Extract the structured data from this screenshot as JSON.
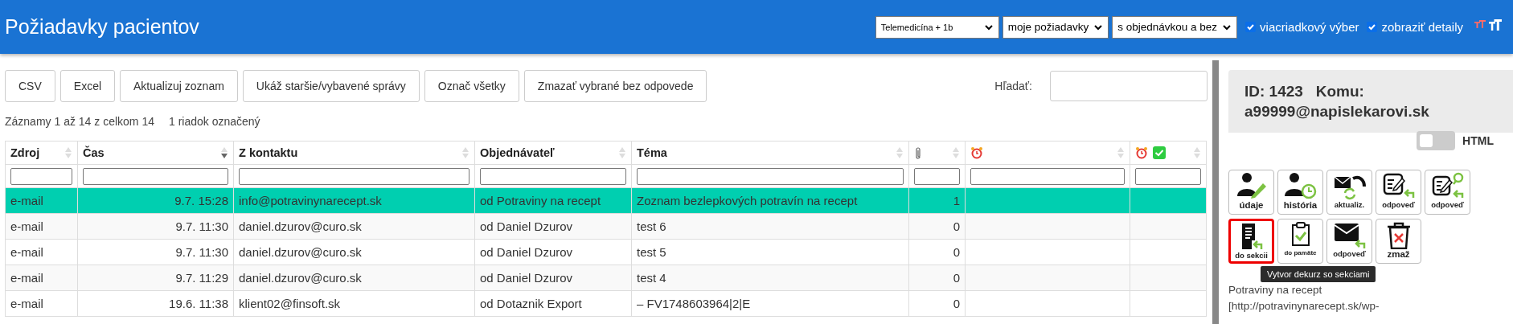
{
  "header": {
    "title": "Požiadavky pacientov",
    "selects": [
      {
        "value": "Telemedicína + 1b",
        "kind": "small"
      },
      {
        "value": "moje požiadavky",
        "kind": "normal"
      },
      {
        "value": "s objednávkou a bez",
        "kind": "normal"
      }
    ],
    "checkboxes": [
      {
        "label": "viacriadkový výber",
        "checked": true
      },
      {
        "label": "zobraziť detaily",
        "checked": true
      }
    ]
  },
  "toolbar": {
    "buttons": [
      "CSV",
      "Excel",
      "Aktualizuj zoznam",
      "Ukáž staršie/vybavené správy",
      "Označ všetky",
      "Zmazať vybrané bez odpovede"
    ],
    "search_label": "Hľadať:"
  },
  "info": [
    "Záznamy 1 až 14 z celkom 14",
    "1 riadok označený"
  ],
  "table": {
    "columns": [
      {
        "kind": "text",
        "label": "Zdroj",
        "sorted": false
      },
      {
        "kind": "text",
        "label": "Čas",
        "sorted": true
      },
      {
        "kind": "text",
        "label": "Z kontaktu",
        "sorted": false
      },
      {
        "kind": "text",
        "label": "Objednávateľ",
        "sorted": false
      },
      {
        "kind": "text",
        "label": "Téma",
        "sorted": false
      },
      {
        "kind": "attachment",
        "sorted": false
      },
      {
        "kind": "alarm",
        "sorted": false
      },
      {
        "kind": "alarm-check",
        "sorted": false
      }
    ],
    "rows": [
      {
        "selected": true,
        "cells": [
          "e-mail",
          "9.7. 15:28",
          "info@potravinynarecept.sk",
          "od Potraviny na recept",
          "Zoznam bezlepkových potravín na recept",
          "1"
        ]
      },
      {
        "selected": false,
        "cells": [
          "e-mail",
          "9.7. 11:30",
          "daniel.dzurov@curo.sk",
          "od Daniel Dzurov",
          "test 6",
          "0"
        ]
      },
      {
        "selected": false,
        "cells": [
          "e-mail",
          "9.7. 11:30",
          "daniel.dzurov@curo.sk",
          "od Daniel Dzurov",
          "test 5",
          "0"
        ]
      },
      {
        "selected": false,
        "cells": [
          "e-mail",
          "9.7. 11:29",
          "daniel.dzurov@curo.sk",
          "od Daniel Dzurov",
          "test 4",
          "0"
        ]
      },
      {
        "selected": false,
        "cells": [
          "e-mail",
          "19.6. 11:38",
          "klient02@finsoft.sk",
          "od Dotaznik Export",
          "– FV1748603964|2|E",
          "0"
        ]
      }
    ]
  },
  "detail": {
    "heading": "ID: 1423   Komu: a99999@napislekarovi.sk",
    "html_toggle": {
      "label": "HTML",
      "on": false
    },
    "action_rows": [
      [
        {
          "label": "údaje",
          "selected": false
        },
        {
          "label": "história",
          "selected": false
        },
        {
          "label": "aktualiz.",
          "selected": false
        },
        {
          "label": "odpoveď",
          "selected": false
        },
        {
          "label": "odpoveď",
          "selected": false
        }
      ],
      [
        {
          "label": "do sekcii",
          "selected": true
        },
        {
          "label": "do pamäte",
          "selected": false
        },
        {
          "label": "odpoveď",
          "selected": false
        },
        {
          "label": "zmaž",
          "selected": false
        }
      ]
    ],
    "tooltip": "Vytvor dekurz so sekciami",
    "body_lines": [
      "Potraviny na recept",
      "[http://potravinynarecept.sk/wp-"
    ]
  }
}
